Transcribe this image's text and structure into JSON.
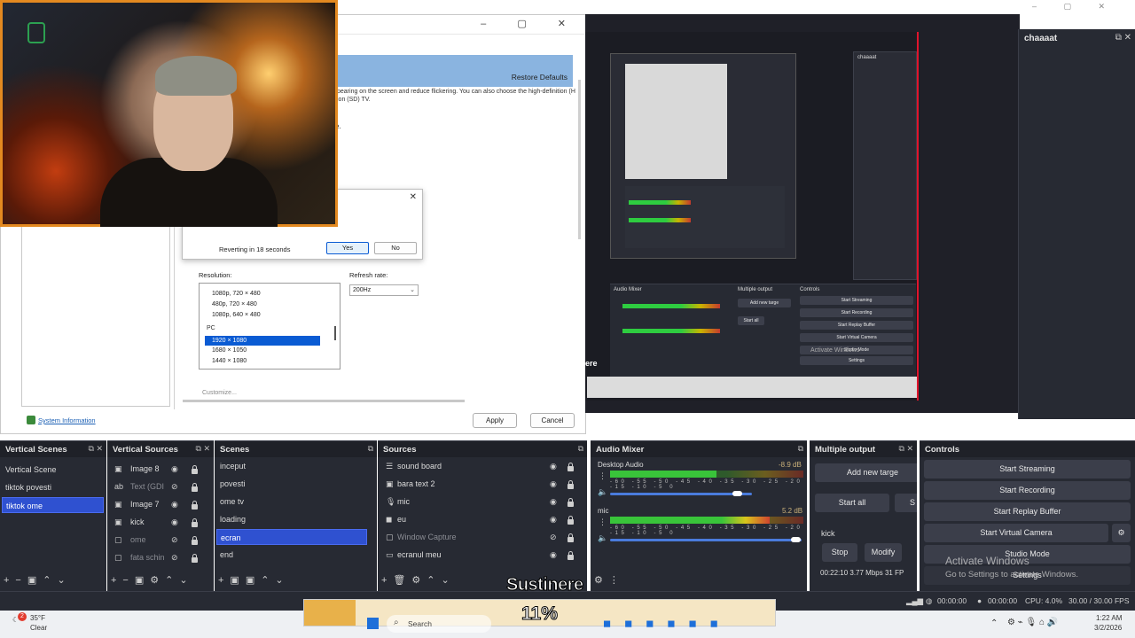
{
  "window_controls": "–  ▢  ✕",
  "control_panel": {
    "restore_defaults": "Restore Defaults",
    "description": "pearing on the screen and reduce flickering. You can also choose the high-definition (H ion (SD) TV.",
    "fragment_e": "e.",
    "system_information": "System Information",
    "resolution_label": "Resolution:",
    "refresh_label": "Refresh rate:",
    "refresh_value": "200Hz",
    "resolutions": [
      "1080p, 720 × 480",
      "480p, 720 × 480",
      "1080p, 640 × 480"
    ],
    "pc_group": "PC",
    "pc_resolutions": [
      "1920 × 1080",
      "1680 × 1050",
      "1440 × 1080"
    ],
    "customize": "Customize...",
    "apply": "Apply",
    "cancel": "Cancel"
  },
  "revert_dialog": {
    "text": "Reverting in 18 seconds",
    "yes": "Yes",
    "no": "No"
  },
  "preview": {
    "chat_title": "chaaaat",
    "ere": "ere",
    "activate_small": "Activate Windows"
  },
  "chat_panel": {
    "title": "chaaaat",
    "icons": "⧉ ✕"
  },
  "docks": {
    "vertical_scenes": {
      "title": "Vertical Scenes",
      "items": [
        "Vertical Scene",
        "tiktok povesti",
        "tiktok ome"
      ]
    },
    "vertical_sources": {
      "title": "Vertical Sources",
      "items": [
        "Image 8",
        "Text (GDI",
        "Image 7",
        "kick",
        "ome",
        "fata schin"
      ]
    },
    "scenes": {
      "title": "Scenes",
      "items": [
        "inceput",
        "povesti",
        "ome tv",
        "loading",
        "ecran",
        "end"
      ]
    },
    "sources": {
      "title": "Sources",
      "items": [
        "sound board",
        "bara text 2",
        "mic",
        "eu",
        "Window Capture",
        "ecranul meu"
      ]
    },
    "audio_mixer": {
      "title": "Audio Mixer",
      "ch1_name": "Desktop Audio",
      "ch1_db": "-8.9 dB",
      "ch2_name": "mic",
      "ch2_db": "5.2 dB",
      "scale": "-60 -55 -50 -45 -40 -35 -30 -25 -20 -15 -10 -5 0"
    },
    "multiple_output": {
      "title": "Multiple output",
      "add_target": "Add new targe",
      "start_all": "Start all",
      "s_btn": "S",
      "kick": "kick",
      "stop": "Stop",
      "modify": "Modify",
      "stats": "00:22:10  3.77 Mbps  31 FP"
    },
    "controls": {
      "title": "Controls",
      "start_streaming": "Start Streaming",
      "start_recording": "Start Recording",
      "start_replay": "Start Replay Buffer",
      "start_vcam": "Start Virtual Camera",
      "studio_mode": "Studio Mode",
      "settings": "Settings"
    }
  },
  "status_bar": {
    "time1": "00:00:00",
    "time2": "00:00:00",
    "cpu": "CPU: 4.0%",
    "fps": "30.00 / 30.00 FPS"
  },
  "activate_windows": {
    "line1": "Activate Windows",
    "line2": "Go to Settings to activate Windows."
  },
  "overlay": {
    "sustinere": "Sustinere",
    "percent": "11%",
    "progress_fraction": 0.11
  },
  "taskbar": {
    "weather_temp": "35°F",
    "weather_cond": "Clear",
    "weather_badge": "2",
    "search": "Search",
    "time": "1:22 AM",
    "date": "3/2/2026"
  },
  "colors": {
    "obs_bg": "#272a33",
    "selection": "#2f51d0",
    "webcam_border": "#e38920",
    "preview_red": "#e0142c"
  }
}
